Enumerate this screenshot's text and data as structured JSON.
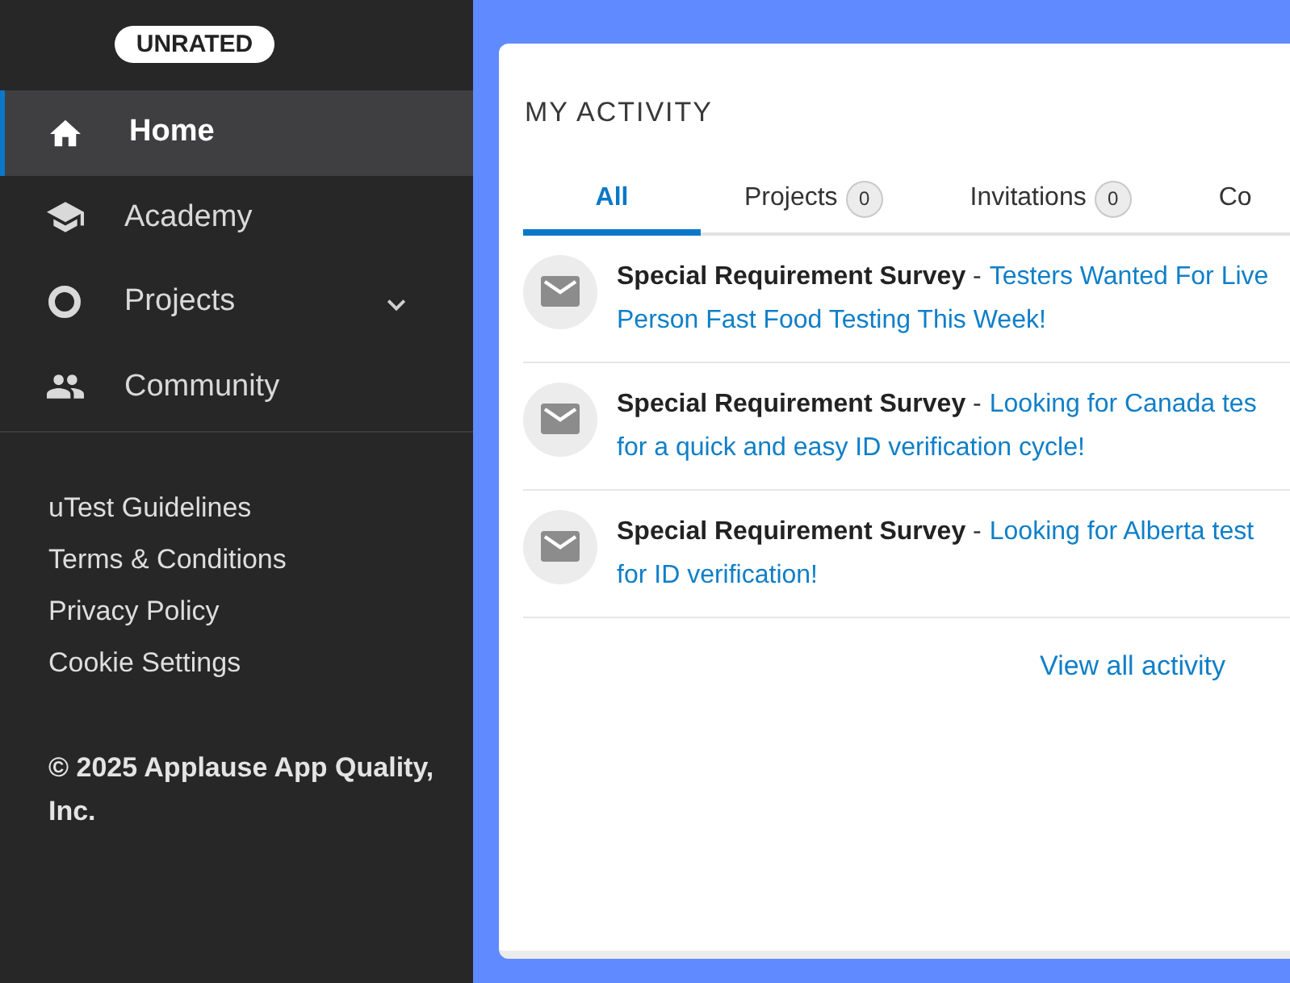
{
  "sidebar": {
    "rating_badge": "UNRATED",
    "nav": [
      {
        "label": "Home",
        "selected": true,
        "expandable": false
      },
      {
        "label": "Academy",
        "selected": false,
        "expandable": false
      },
      {
        "label": "Projects",
        "selected": false,
        "expandable": true
      },
      {
        "label": "Community",
        "selected": false,
        "expandable": false
      }
    ],
    "links": [
      "uTest Guidelines",
      "Terms & Conditions",
      "Privacy Policy",
      "Cookie Settings"
    ],
    "copyright": "© 2025 Applause App Quality, Inc."
  },
  "activity": {
    "title": "MY ACTIVITY",
    "tabs": [
      {
        "label": "All",
        "selected": true
      },
      {
        "label": "Projects",
        "count": "0",
        "selected": false
      },
      {
        "label": "Invitations",
        "count": "0",
        "selected": false
      },
      {
        "label": "Co",
        "selected": false
      }
    ],
    "items": [
      {
        "heading": "**Special Requirement Survey** -",
        "link_lines": [
          "Testers Wanted For Live",
          "Person Fast Food Testing This Week!"
        ]
      },
      {
        "heading": "**Special Requirement Survey** -",
        "link_lines": [
          "Looking for Canada tes",
          "for a quick and easy ID verification cycle!"
        ]
      },
      {
        "heading": "**Special Requirement Survey** -",
        "link_lines": [
          "Looking for Alberta test",
          "for ID verification!"
        ]
      }
    ],
    "view_all": "View all activity"
  }
}
